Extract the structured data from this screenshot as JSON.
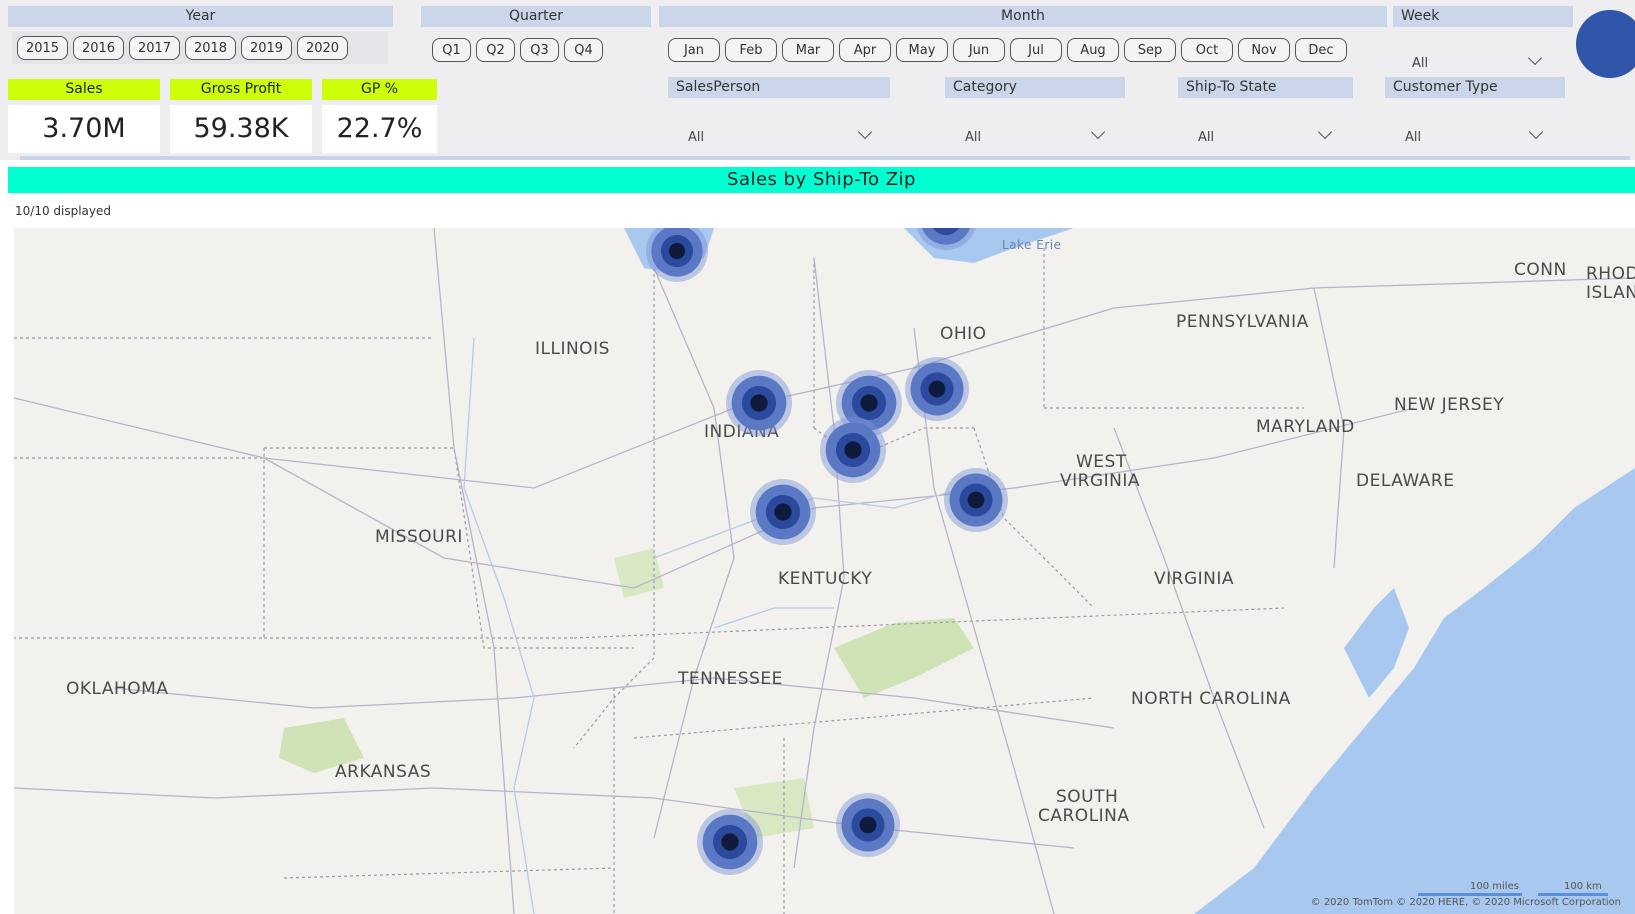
{
  "filters": {
    "year": {
      "header": "Year",
      "options": [
        "2015",
        "2016",
        "2017",
        "2018",
        "2019",
        "2020"
      ]
    },
    "quarter": {
      "header": "Quarter",
      "options": [
        "Q1",
        "Q2",
        "Q3",
        "Q4"
      ]
    },
    "month": {
      "header": "Month",
      "options": [
        "Jan",
        "Feb",
        "Mar",
        "Apr",
        "May",
        "Jun",
        "Jul",
        "Aug",
        "Sep",
        "Oct",
        "Nov",
        "Dec"
      ]
    },
    "week": {
      "header": "Week",
      "value": "All"
    },
    "salesperson": {
      "header": "SalesPerson",
      "value": "All"
    },
    "category": {
      "header": "Category",
      "value": "All"
    },
    "ship_to_state": {
      "header": "Ship-To State",
      "value": "All"
    },
    "customer_type": {
      "header": "Customer Type",
      "value": "All"
    }
  },
  "kpis": {
    "sales": {
      "label": "Sales",
      "value": "3.70M"
    },
    "gross_profit": {
      "label": "Gross Profit",
      "value": "59.38K"
    },
    "gp_pct": {
      "label": "GP %",
      "value": "22.7%"
    }
  },
  "map": {
    "title": "Sales by Ship-To Zip",
    "displayed": "10/10 displayed",
    "state_labels": [
      "ILLINOIS",
      "INDIANA",
      "OHIO",
      "PENNSYLVANIA",
      "NEW JERSEY",
      "MARYLAND",
      "DELAWARE",
      "WEST",
      "VIRGINIA",
      "VIRGINIA",
      "KENTUCKY",
      "MISSOURI",
      "TENNESSEE",
      "NORTH CAROLINA",
      "SOUTH",
      "CAROLINA",
      "OKLAHOMA",
      "ARKANSAS",
      "CONN",
      "RHOD",
      "ISLAN"
    ],
    "water_label": "Lake Erie",
    "scale_miles": "100 miles",
    "scale_km": "100 km",
    "copyright": "© 2020 TomTom © 2020 HERE, © 2020 Microsoft Corporation",
    "colors": {
      "bubble_core": "#101a3d",
      "bubble_ring": "#2b4a9e",
      "water": "#a8c8ef",
      "land": "#f2f1ed"
    }
  }
}
